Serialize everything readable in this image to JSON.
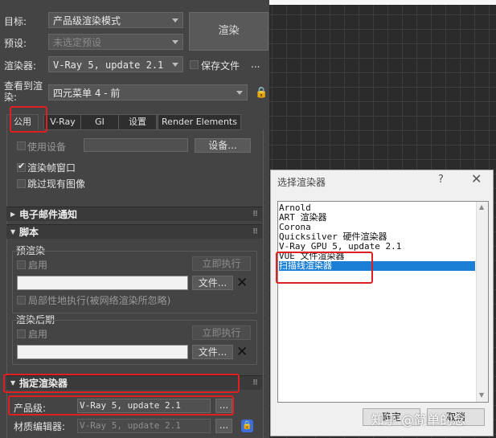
{
  "top": {
    "target_label": "目标:",
    "target_value": "产品级渲染模式",
    "preset_label": "预设:",
    "preset_value": "未选定预设",
    "renderer_label": "渲染器:",
    "renderer_value": "V-Ray 5, update 2.1",
    "save_file_label": "保存文件",
    "more_label": "...",
    "view_label": "查看到渲染:",
    "view_value": "四元菜单 4 - 前",
    "render_button": "渲染"
  },
  "tabs": [
    "公用",
    "V-Ray",
    "GI",
    "设置",
    "Render Elements"
  ],
  "common": {
    "use_device_label": "使用设备",
    "device_button": "设备...",
    "render_frame_window_label": "渲染帧窗口",
    "skip_existing_label": "跳过现有图像"
  },
  "rollouts": {
    "email": "电子邮件通知",
    "script": "脚本",
    "assign_renderer": "指定渲染器"
  },
  "script": {
    "pre_render_label": "预渲染",
    "enable_label": "启用",
    "execute_now": "立即执行",
    "file_button": "文件...",
    "local_execute_label": "局部性地执行(被网络渲染所忽略)",
    "post_render_label": "渲染后期",
    "enable_label_2": "启用",
    "execute_now_2": "立即执行",
    "file_button_2": "文件..."
  },
  "assign": {
    "production_label": "产品级:",
    "production_value": "V-Ray 5, update 2.1",
    "material_editor_label": "材质编辑器:",
    "material_editor_value": "V-Ray 5, update 2.1",
    "ellipsis": "...",
    "ellipsis_2": "..."
  },
  "dialog": {
    "title": "选择渲染器",
    "help": "?",
    "close": "✕",
    "items": [
      "Arnold",
      "ART 渲染器",
      "Corona",
      "Quicksilver 硬件渲染器",
      "V-Ray GPU 5, update 2.1",
      "VUE 文件渲染器",
      "扫描线渲染器"
    ],
    "selected_index": 6,
    "ok": "确定",
    "cancel": "取消"
  },
  "watermark": "知乎 @简单的念",
  "colors": {
    "highlight_red": "#e02020",
    "selection_blue": "#1b7fd6"
  }
}
